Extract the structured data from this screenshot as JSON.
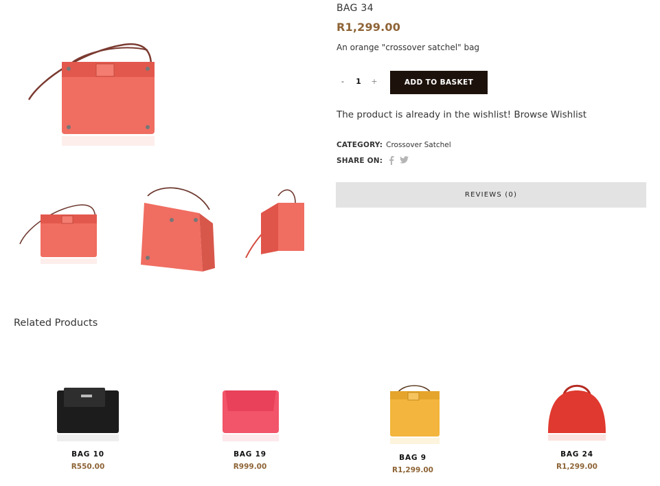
{
  "product": {
    "title": "BAG 34",
    "price": "R1,299.00",
    "description": "An orange \"crossover satchel\" bag",
    "quantity": {
      "minus": "-",
      "value": "1",
      "plus": "+"
    },
    "add_to_basket": "ADD TO BASKET",
    "wishlist_message": "The product is already in the wishlist!",
    "wishlist_link": "Browse Wishlist",
    "category_label": "CATEGORY:",
    "category_value": "Crossover Satchel",
    "share_label": "SHARE ON:",
    "share_icons": [
      "facebook-icon",
      "twitter-icon"
    ],
    "reviews_tab": "REVIEWS (0)",
    "colors": {
      "bag": "#f06d61",
      "accent_price": "#8e6436",
      "button": "#1d120b",
      "tab_bg": "#e3e3e3"
    }
  },
  "related": {
    "title": "Related Products",
    "items": [
      {
        "name": "BAG 10",
        "price": "R550.00",
        "color": "#1c1c1c"
      },
      {
        "name": "BAG 19",
        "price": "R999.00",
        "color": "#f2546a"
      },
      {
        "name": "BAG 9",
        "price": "R1,299.00",
        "color": "#f3b53d"
      },
      {
        "name": "BAG 24",
        "price": "R1,299.00",
        "color": "#e0392f"
      }
    ]
  }
}
